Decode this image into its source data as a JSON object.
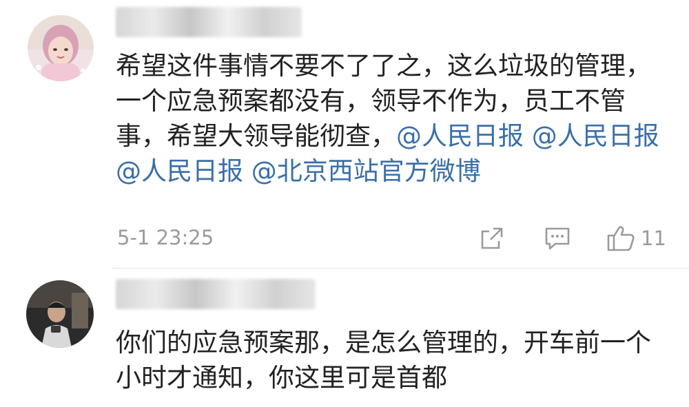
{
  "comments": [
    {
      "text_parts": [
        "希望这件事情不要不了了之，这么垃圾的管理，一个应急预案都没有，领导不作为，员工不管事，希望大领导能彻查，",
        "@人民日报",
        " ",
        "@人民日报",
        " ",
        "@人民日报",
        " ",
        "@北京西站官方微博"
      ],
      "timestamp": "5-1 23:25",
      "like_count": "11",
      "icons": {
        "share": "share-icon",
        "comment": "comment-icon",
        "like": "thumbs-up-icon"
      }
    },
    {
      "text": "你们的应急预案那，是怎么管理的，开车前一个小时才通知，你这里可是首都"
    }
  ],
  "colors": {
    "text": "#222222",
    "mention": "#3a6fa8",
    "meta": "#9a9a9a",
    "divider": "#e3e3e3"
  }
}
